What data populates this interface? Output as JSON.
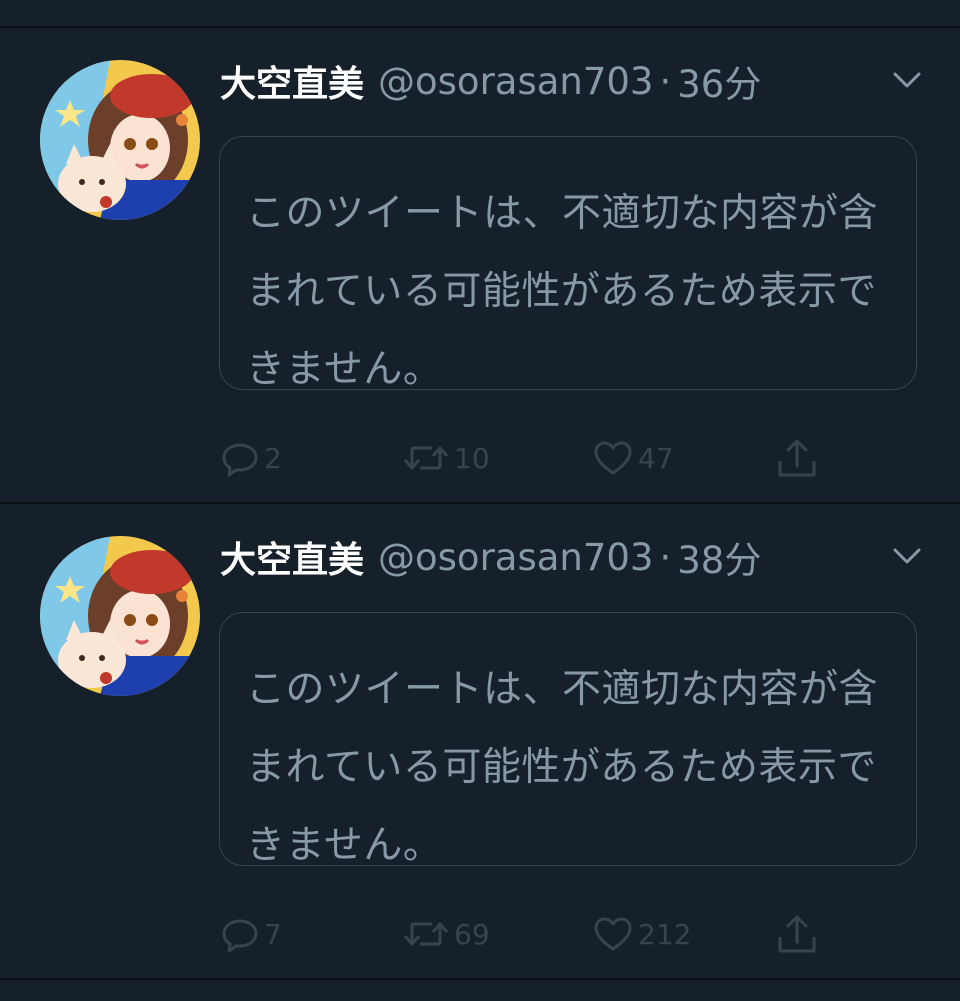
{
  "tweets": [
    {
      "author": {
        "name": "大空直美",
        "handle": "@osorasan703"
      },
      "separator": "·",
      "time": "36分",
      "withheld_notice": "このツイートは、不適切な内容が含まれている可能性があるため表示できません。",
      "stats": {
        "replies": "2",
        "retweets": "10",
        "likes": "47"
      }
    },
    {
      "author": {
        "name": "大空直美",
        "handle": "@osorasan703"
      },
      "separator": "·",
      "time": "38分",
      "withheld_notice": "このツイートは、不適切な内容が含まれている可能性があるため表示できません。",
      "stats": {
        "replies": "7",
        "retweets": "69",
        "likes": "212"
      }
    }
  ],
  "icons": {
    "caret": "chevron-down-icon",
    "reply": "reply-icon",
    "retweet": "retweet-icon",
    "like": "heart-icon",
    "share": "share-icon"
  },
  "colors": {
    "background": "#15202b",
    "primary_text": "#ffffff",
    "secondary_text": "#8899a6",
    "border": "#38444d",
    "action_icon": "#38444d"
  }
}
